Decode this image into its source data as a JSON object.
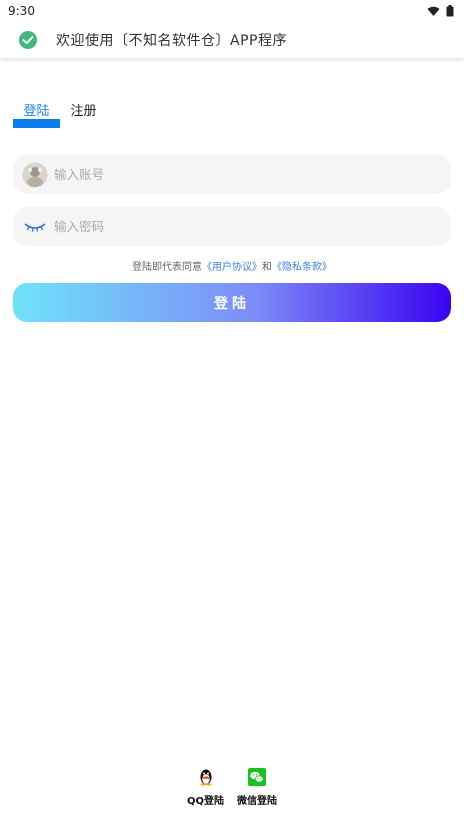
{
  "status_bar": {
    "time": "9:30"
  },
  "toast": {
    "message": "欢迎使用〔不知名软件仓〕APP程序"
  },
  "tabs": [
    {
      "label": "登陆",
      "active": true
    },
    {
      "label": "注册",
      "active": false
    }
  ],
  "account_field": {
    "placeholder": "输入账号",
    "value": ""
  },
  "password_field": {
    "placeholder": "输入密码",
    "value": ""
  },
  "agreement": {
    "prefix": "登陆即代表同意",
    "user_agreement": "《用户协议》",
    "conjunction": "和",
    "privacy_policy": "《隐私条款》"
  },
  "login_button": {
    "label": "登陆"
  },
  "social_login": {
    "qq_label": "QQ登陆",
    "wechat_label": "微信登陆"
  },
  "colors": {
    "accent": "#0a7cf0",
    "toast_check": "#3fb97a",
    "button_gradient_start": "#6fe3fa",
    "button_gradient_end": "#3a03f2",
    "wechat_green": "#19c11c"
  }
}
